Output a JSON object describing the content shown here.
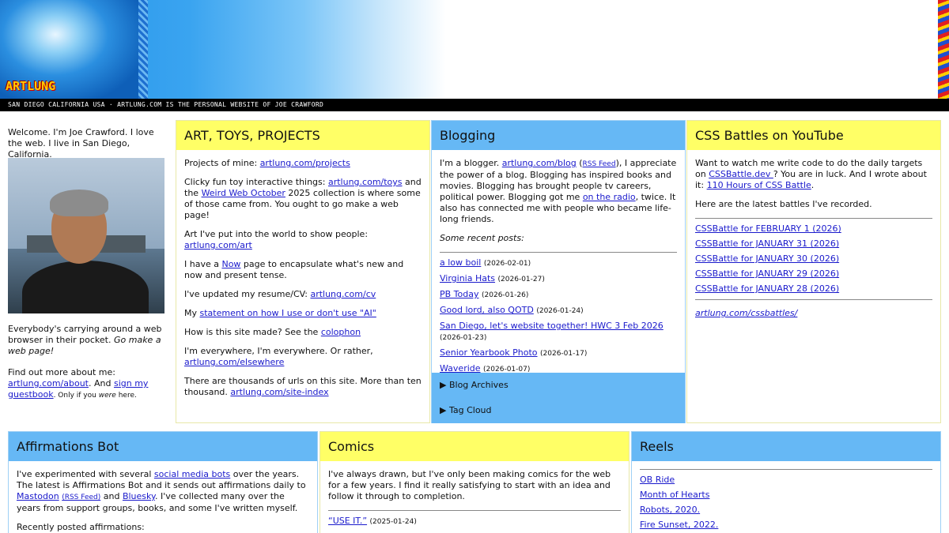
{
  "header": {
    "logo": "ARTLUNG",
    "tagline": "San Diego California USA · ARTLUNG.com is the personal website of Joe Crawford"
  },
  "intro": {
    "welcome": "Welcome. I'm Joe Crawford. I love the web. I live in San Diego, California.",
    "pocket_prefix": "Everybody's carrying around a web browser in their pocket. ",
    "pocket_em": "Go make a web page!",
    "find_prefix": "Find out more about me: ",
    "about_link": "artlung.com/about",
    "and_text": ". And ",
    "guestbook_link": "sign my guestbook",
    "only_prefix": ". Only if you ",
    "only_em": "were",
    "only_suffix": " here."
  },
  "art": {
    "title": "ART, TOYS, PROJECTS",
    "p1_text": "Projects of mine: ",
    "p1_link": "artlung.com/projects",
    "p2_text": "Clicky fun toy interactive things: ",
    "p2_link": "artlung.com/toys",
    "p2_mid": " and the ",
    "p2_link2": "Weird Web October",
    "p2_end": " 2025 collection is where some of those came from. You ought to go make a web page!",
    "p3_text": "Art I've put into the world to show people: ",
    "p3_link": "artlung.com/art",
    "p4_text": "I have a ",
    "p4_link": "Now",
    "p4_end": " page to encapsulate what's new and now and present tense.",
    "p5_text": "I've updated my resume/CV: ",
    "p5_link": "artlung.com/cv",
    "p6_text": "My ",
    "p6_link": "statement on how I use or don't use \"AI\"",
    "p7_text": "How is this site made? See the ",
    "p7_link": "colophon",
    "p8_text": "I'm everywhere, I'm everywhere. Or rather, ",
    "p8_link": "artlung.com/elsewhere",
    "p9_text": "There are thousands of urls on this site. More than ten thousand. ",
    "p9_link": "artlung.com/site-index"
  },
  "blog": {
    "title": "Blogging",
    "p1_a": "I'm a blogger. ",
    "p1_link": "artlung.com/blog",
    "p1_b": " (",
    "p1_rss": "RSS Feed",
    "p1_c": "), I appreciate the power of a blog. Blogging has inspired books and movies. Blogging has brought people tv careers, political power. Blogging got me ",
    "p1_radio": "on the radio",
    "p1_d": ", twice. It also has connected me with people who became life-long friends.",
    "recent_label": "Some recent posts:",
    "posts": [
      {
        "title": "a low boil",
        "date": "(2026-02-01)"
      },
      {
        "title": "Virginia Hats",
        "date": "(2026-01-27)"
      },
      {
        "title": "PB Today",
        "date": "(2026-01-26)"
      },
      {
        "title": "Good lord, also QOTD",
        "date": "(2026-01-24)"
      },
      {
        "title": "San Diego, let's website together! HWC 3 Feb 2026",
        "date": "(2026-01-23)"
      },
      {
        "title": "Senior Yearbook Photo",
        "date": "(2026-01-17)"
      },
      {
        "title": "Waveride",
        "date": "(2026-01-07)"
      }
    ],
    "archives": "Blog Archives",
    "tagcloud": "Tag Cloud"
  },
  "css": {
    "title": "CSS Battles on YouTube",
    "p1_a": "Want to watch me write code to do the daily targets on ",
    "p1_link": "CSSBattle.dev ",
    "p1_b": "? You are in luck. And I wrote about it: ",
    "p1_link2": "110 Hours of CSS Battle",
    "p1_c": ".",
    "p2": "Here are the latest battles I've recorded.",
    "battles": [
      "CSSBattle for FEBRUARY 1 (2026)",
      "CSSBattle for JANUARY 31 (2026)",
      "CSSBattle for JANUARY 30 (2026)",
      "CSSBattle for JANUARY 29 (2026)",
      "CSSBattle for JANUARY 28 (2026)"
    ],
    "more_link": "artlung.com/cssbattles/"
  },
  "affirm": {
    "title": "Affirmations Bot",
    "p1_a": "I've experimented with several ",
    "p1_link": "social media bots",
    "p1_b": " over the years. The latest is Affirmations Bot and it sends out affirmations daily to ",
    "p1_mastodon": "Mastodon",
    "p1_rss": "(RSS Feed)",
    "p1_c": " and ",
    "p1_bluesky": "Bluesky",
    "p1_d": ". I've collected many over the years from support groups, books, and some I've written myself.",
    "recent": "Recently posted affirmations:"
  },
  "comics": {
    "title": "Comics",
    "p1": "I've always drawn, but I've only been making comics for the web for a few years. I find it really satisfying to start with an idea and follow it through to completion.",
    "item_title": "“USE IT.”",
    "item_date": "(2025-01-24)"
  },
  "reels": {
    "title": "Reels",
    "items": [
      "OB Ride",
      "Month of Hearts",
      "Robots, 2020.",
      "Fire Sunset, 2022."
    ]
  },
  "colors": {
    "yellow": "#ffff66",
    "blue": "#66b8f5",
    "link": "#1a1acc"
  }
}
